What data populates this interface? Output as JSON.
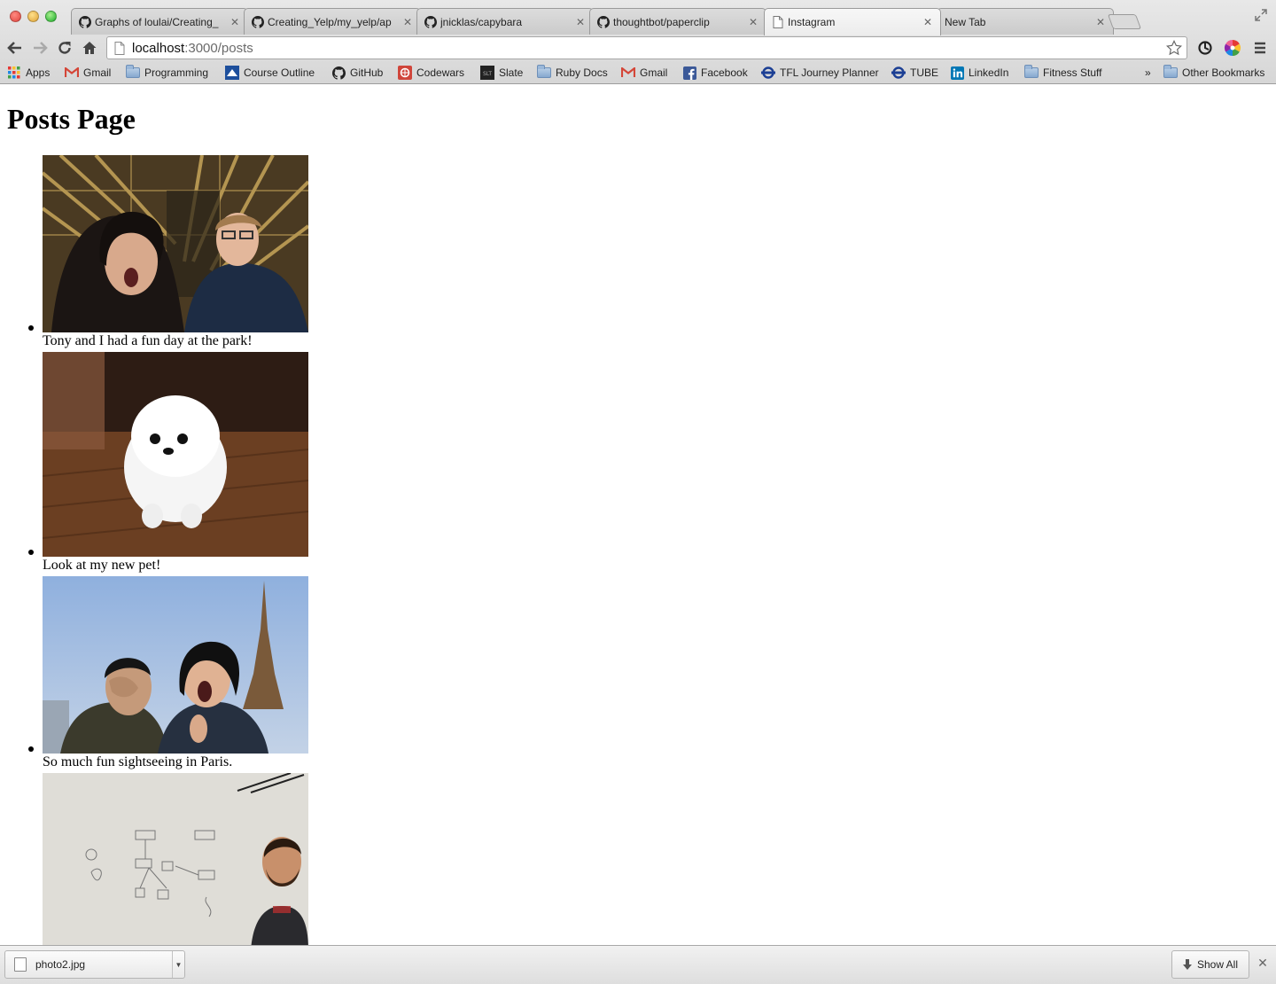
{
  "tabs": [
    {
      "label": "Graphs of loulai/Creating_",
      "icon": "github-icon",
      "active": false
    },
    {
      "label": "Creating_Yelp/my_yelp/ap",
      "icon": "github-icon",
      "active": false
    },
    {
      "label": "jnicklas/capybara",
      "icon": "github-icon",
      "active": false
    },
    {
      "label": "thoughtbot/paperclip",
      "icon": "github-icon",
      "active": false
    },
    {
      "label": "Instagram",
      "icon": "page-icon",
      "active": true
    },
    {
      "label": "New Tab",
      "icon": "",
      "active": false
    }
  ],
  "address": {
    "host": "localhost",
    "path": ":3000/posts"
  },
  "bookmarks": [
    {
      "label": "Apps",
      "icon": "apps-grid-icon"
    },
    {
      "label": "Gmail",
      "icon": "gmail-icon"
    },
    {
      "label": "Programming",
      "icon": "folder-icon"
    },
    {
      "label": "Course Outline",
      "icon": "course-icon"
    },
    {
      "label": "GitHub",
      "icon": "github-icon"
    },
    {
      "label": "Codewars",
      "icon": "codewars-icon"
    },
    {
      "label": "Slate",
      "icon": "slate-icon"
    },
    {
      "label": "Ruby Docs",
      "icon": "folder-icon"
    },
    {
      "label": "Gmail",
      "icon": "gmail-icon"
    },
    {
      "label": "Facebook",
      "icon": "facebook-icon"
    },
    {
      "label": "TFL Journey Planner",
      "icon": "tfl-roundel-icon"
    },
    {
      "label": "TUBE",
      "icon": "tfl-roundel-icon"
    },
    {
      "label": "LinkedIn",
      "icon": "linkedin-icon"
    },
    {
      "label": "Fitness Stuff",
      "icon": "folder-icon"
    }
  ],
  "bookmarks_overflow": "»",
  "other_bookmarks": "Other Bookmarks",
  "page": {
    "title": "Posts Page",
    "posts": [
      {
        "caption": "Tony and I had a fun day at the park!",
        "image": "roller-coaster selfie photo"
      },
      {
        "caption": "Look at my new pet!",
        "image": "white pomeranian puppy photo"
      },
      {
        "caption": "So much fun sightseeing in Paris.",
        "image": "eiffel tower selfie photo"
      },
      {
        "caption": "",
        "image": "whiteboard diagram photo"
      }
    ]
  },
  "downloads": {
    "file": "photo2.jpg",
    "show_all": "Show All"
  },
  "colors": {
    "gmail_red": "#d44638",
    "facebook_blue": "#3b5998",
    "linkedin_blue": "#0077b5",
    "tfl_blue": "#1c3f94",
    "codewars_red": "#d0453a"
  }
}
